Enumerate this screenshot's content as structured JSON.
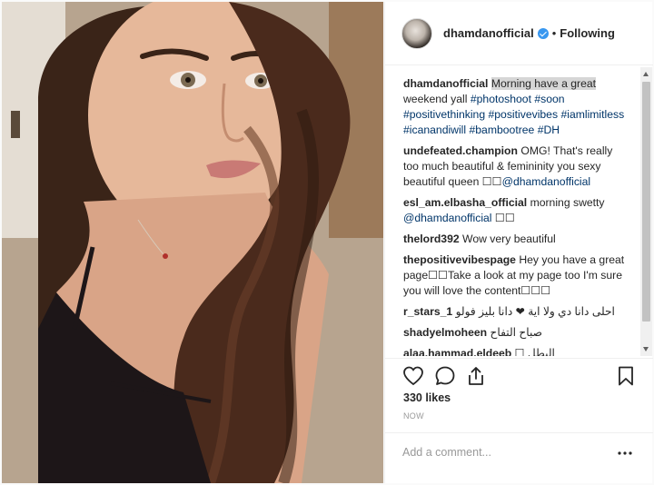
{
  "post": {
    "username": "dhamdanofficial",
    "separator": "•",
    "follow_status": "Following"
  },
  "caption": {
    "username": "dhamdanofficial",
    "highlighted": "Morning have a great",
    "text": " weekend yall ",
    "hashtags": [
      "#photoshoot",
      "#soon",
      "#positivethinking",
      "#positivevibes",
      "#iamlimitless",
      "#icanandiwill",
      "#bambootree",
      "#DH"
    ]
  },
  "comments": [
    {
      "user": "undefeated.champion",
      "text": "OMG! That's really too much beautiful & femininity you sexy beautiful queen ☐☐",
      "mention": "@dhamdanofficial",
      "after": ""
    },
    {
      "user": "esl_am.elbasha_official",
      "text": "morning swetty ",
      "mention": "@dhamdanofficial",
      "after": " ☐☐"
    },
    {
      "user": "thelord392",
      "text": "Wow very beautiful",
      "mention": "",
      "after": ""
    },
    {
      "user": "thepositivevibespage",
      "text": "Hey you have a great page☐☐Take a look at my page too I'm sure you will love the content☐☐☐",
      "mention": "",
      "after": ""
    },
    {
      "user": "r_stars_1",
      "text": "احلى دانا دي ولا اية ❤ دانا بليز فولو",
      "mention": "",
      "after": "",
      "rtl": true
    },
    {
      "user": "shadyelmoheen",
      "text": "صباح التفاح",
      "mention": "",
      "after": "",
      "rtl": true
    },
    {
      "user": "alaa.hammad.eldeeb",
      "text": "البطل ☐",
      "mention": "",
      "after": "",
      "rtl": true
    }
  ],
  "likes": "330 likes",
  "time": "NOW",
  "add_comment": {
    "placeholder": "Add a comment..."
  },
  "colors": {
    "link": "#003569",
    "verified": "#3897f0",
    "muted": "#999999"
  },
  "icons": [
    "heart-icon",
    "comment-icon",
    "share-icon",
    "bookmark-icon",
    "more-icon",
    "verified-icon"
  ]
}
